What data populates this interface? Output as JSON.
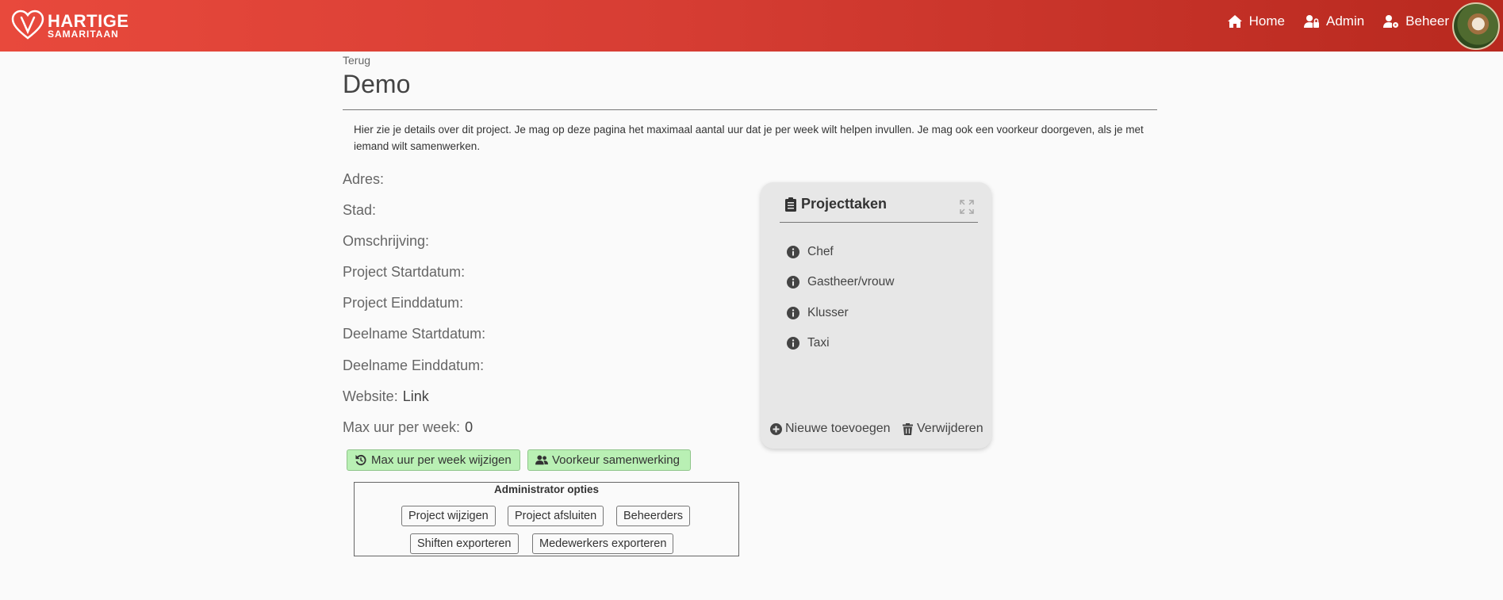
{
  "header": {
    "logo_line1": "HARTIGE",
    "logo_line2": "SAMARITAAN",
    "nav": [
      {
        "label": "Home",
        "icon": "home-icon"
      },
      {
        "label": "Admin",
        "icon": "user-lock-icon"
      },
      {
        "label": "Beheer",
        "icon": "user-cog-icon"
      }
    ],
    "avatar_icon": "user-avatar"
  },
  "page": {
    "back_label": "Terug",
    "title": "Demo",
    "intro": "Hier zie je details over dit project. Je mag op deze pagina het maximaal aantal uur dat je per week wilt helpen invullen. Je mag ook een voorkeur doorgeven, als je met iemand wilt samenwerken."
  },
  "fields": {
    "adres_label": "Adres:",
    "stad_label": "Stad:",
    "omschrijving_label": "Omschrijving:",
    "project_start_label": "Project Startdatum:",
    "project_eind_label": "Project Einddatum:",
    "deelname_start_label": "Deelname Startdatum:",
    "deelname_eind_label": "Deelname Einddatum:",
    "website_label": "Website:",
    "website_value": "Link",
    "max_uur_label": "Max uur per week:",
    "max_uur_value": "0"
  },
  "actions": {
    "max_uur_button": "Max uur per week wijzigen",
    "voorkeur_button": "Voorkeur samenwerking"
  },
  "admin": {
    "title": "Administrator opties",
    "buttons": {
      "project_wijzigen": "Project wijzigen",
      "project_afsluiten": "Project afsluiten",
      "beheerders": "Beheerders",
      "shiften_exporteren": "Shiften exporteren",
      "medewerkers_exporteren": "Medewerkers exporteren"
    }
  },
  "projecttaken": {
    "title": "Projecttaken",
    "tasks": [
      "Chef",
      "Gastheer/vrouw",
      "Klusser",
      "Taxi"
    ],
    "add_label": "Nieuwe toevoegen",
    "delete_label": "Verwijderen"
  },
  "colors": {
    "header_start": "#e8493c",
    "header_end": "#b8291f",
    "green_button": "#b9f0b4"
  }
}
